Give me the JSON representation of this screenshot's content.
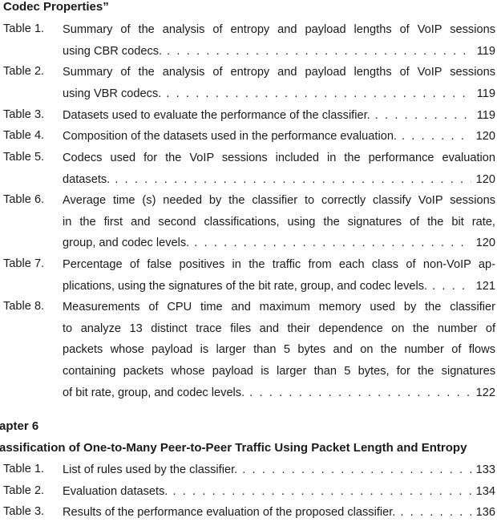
{
  "sections": [
    {
      "heading": "Codec Properties”",
      "entries": [
        {
          "label": "Table 1.",
          "lines": [
            "Summary of the analysis of entropy and payload lengths of VoIP sessions",
            "using CBR codecs."
          ],
          "page": "119"
        },
        {
          "label": "Table 2.",
          "lines": [
            "Summary of the analysis of entropy and payload lengths of VoIP sessions",
            "using VBR codecs."
          ],
          "page": "119"
        },
        {
          "label": "Table 3.",
          "lines": [
            "Datasets used to evaluate the performance of the classifier."
          ],
          "page": "119"
        },
        {
          "label": "Table 4.",
          "lines": [
            "Composition of the datasets used in the performance evaluation."
          ],
          "page": "120"
        },
        {
          "label": "Table 5.",
          "lines": [
            "Codecs used for the VoIP sessions included in the performance evaluation",
            "datasets."
          ],
          "page": "120"
        },
        {
          "label": "Table 6.",
          "lines": [
            "Average time (s) needed by the classifier to correctly classify VoIP sessions",
            "in the first and second classifications, using the signatures of the bit rate,",
            "group, and codec levels."
          ],
          "page": "120"
        },
        {
          "label": "Table 7.",
          "lines": [
            "Percentage of false positives in the traffic from each class of non-VoIP ap-",
            "plications, using the signatures of the bit rate, group, and codec levels."
          ],
          "page": "121"
        },
        {
          "label": "Table 8.",
          "lines": [
            "Measurements of CPU time and maximum memory used by the classifier",
            "to analyze 13 distinct trace files and their dependence on the number of",
            "packets whose payload is larger than 5 bytes and on the number of flows",
            "containing packets whose payload is larger than 5 bytes, for the signatures",
            "of bit rate, group, and codec levels."
          ],
          "page": "122"
        }
      ]
    },
    {
      "chapter": "apter 6",
      "heading": "assification of One-to-Many Peer-to-Peer Traffic Using Packet Length and Entropy",
      "entries": [
        {
          "label": "Table 1.",
          "lines": [
            "List of rules used by the classifier."
          ],
          "page": "133"
        },
        {
          "label": "Table 2.",
          "lines": [
            "Evaluation datasets."
          ],
          "page": "134"
        },
        {
          "label": "Table 3.",
          "lines": [
            "Results of the performance evaluation of the proposed classifier."
          ],
          "page": "136"
        }
      ]
    }
  ]
}
